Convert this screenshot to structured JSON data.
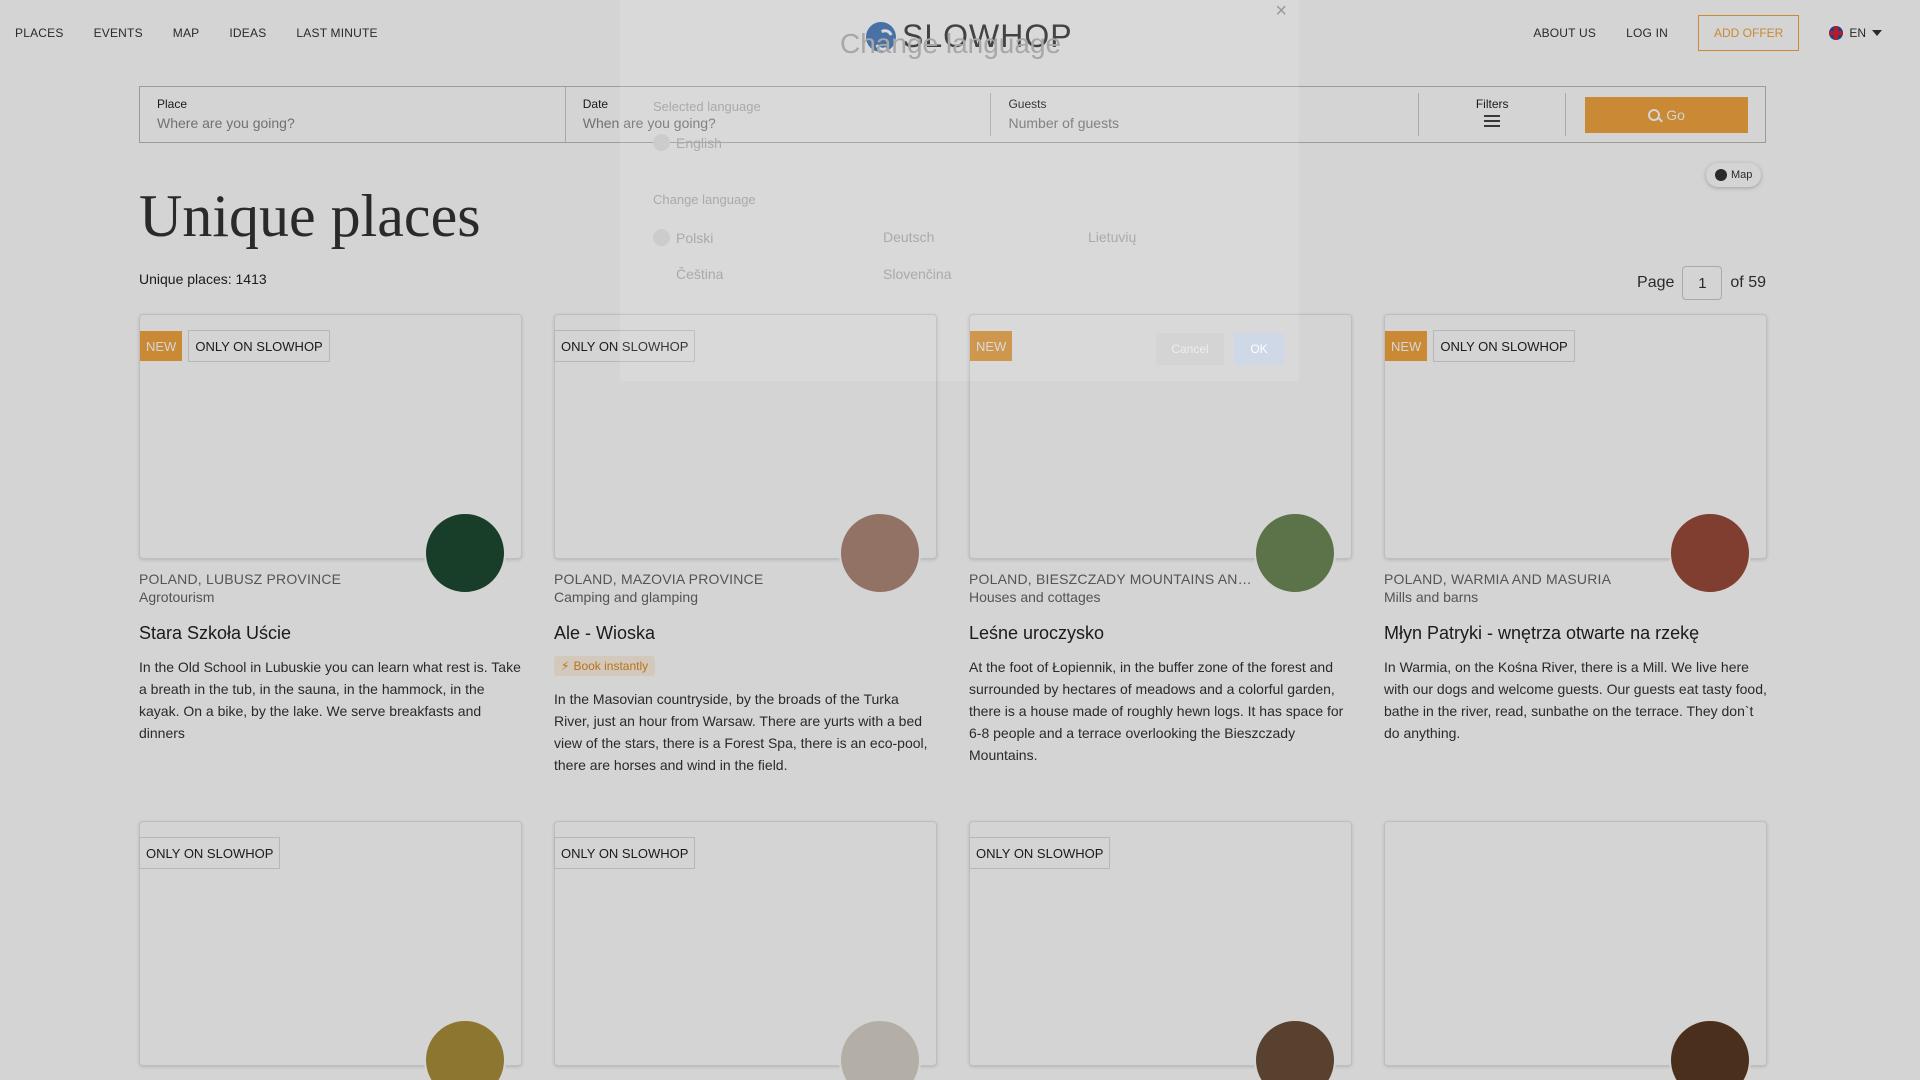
{
  "nav": {
    "left": [
      "PLACES",
      "EVENTS",
      "MAP",
      "IDEAS",
      "LAST MINUTE"
    ],
    "logo_text": "SLOWHOP",
    "right": [
      "ABOUT US",
      "LOG IN"
    ],
    "add_offer": "ADD OFFER",
    "lang": "EN"
  },
  "search": {
    "place_label": "Place",
    "place_placeholder": "Where are you going?",
    "date_label": "Date",
    "date_placeholder": "When are you going?",
    "guests_label": "Guests",
    "guests_placeholder": "Number of guests",
    "filters_label": "Filters",
    "go_label": "Go"
  },
  "map_button": "Map",
  "title": "Unique places",
  "count": "Unique places: 1413",
  "pager": {
    "page_label": "Page",
    "current": "1",
    "of_label": "of 59"
  },
  "cards": [
    {
      "badges": [
        "NEW",
        "ONLY ON SLOWHOP"
      ],
      "location": "POLAND, LUBUSZ PROVINCE",
      "category": "Agrotourism",
      "title": "Stara Szkoła Uście",
      "description": "In the Old School in Lubuskie you can learn what rest is. Take a breath in the tub, in the sauna, in the hammock, in the kayak. On a bike, by the lake. We serve breakfasts and dinners",
      "avatar_color": "#1e4a32"
    },
    {
      "badges": [
        "ONLY ON SLOWHOP"
      ],
      "location": "POLAND, MAZOVIA PROVINCE",
      "category": "Camping and glamping",
      "title": "Ale - Wioska",
      "book": "Book instantly",
      "description": "In the Masovian countryside, by the broads of the Turka River, just an hour from Warsaw. There are yurts with a bed view of the stars, there is a Forest Spa, there is an eco-pool, there are horses and wind in the field.",
      "avatar_color": "#b08a7a"
    },
    {
      "badges": [
        "NEW"
      ],
      "location": "POLAND, BIESZCZADY MOUNTAINS AND...",
      "category": "Houses and cottages",
      "title": "Leśne uroczysko",
      "description": "At the foot of Łopiennik, in the buffer zone of the forest and surrounded by hectares of meadows and a colorful garden, there is a house made of roughly hewn logs. It has space for 6-8 people and a terrace overlooking the Bieszczady Mountains.",
      "avatar_color": "#6f8b5a"
    },
    {
      "badges": [
        "NEW",
        "ONLY ON SLOWHOP"
      ],
      "location": "POLAND, WARMIA AND MASURIA",
      "category": "Mills and barns",
      "title": "Młyn Patryki - wnętrza otwarte na rzekę",
      "description": "In Warmia, on the Kośna River, there is a Mill. We live here with our dogs and welcome guests. Our guests eat tasty food, bathe in the river, read, sunbathe on the terrace. They don`t do anything.",
      "avatar_color": "#9a4b3c"
    },
    {
      "badges": [
        "ONLY ON SLOWHOP"
      ],
      "avatar_color": "#a98e3a"
    },
    {
      "badges": [
        "ONLY ON SLOWHOP"
      ],
      "avatar_color": "#d8d2c8"
    },
    {
      "badges": [
        "ONLY ON SLOWHOP"
      ],
      "avatar_color": "#6b4f3a"
    },
    {
      "badges": [],
      "avatar_color": "#5a3a22"
    }
  ],
  "modal": {
    "title": "Change language",
    "close": "×",
    "selected_label": "Selected language",
    "selected": "English",
    "change_label": "Change language",
    "options": [
      "Polski",
      "Deutsch",
      "Lietuvių",
      "Čeština",
      "Slovenčina"
    ],
    "cancel": "Cancel",
    "ok": "OK"
  },
  "colors": {
    "accent": "#f2a540",
    "brand_blue": "#3a71b8"
  }
}
